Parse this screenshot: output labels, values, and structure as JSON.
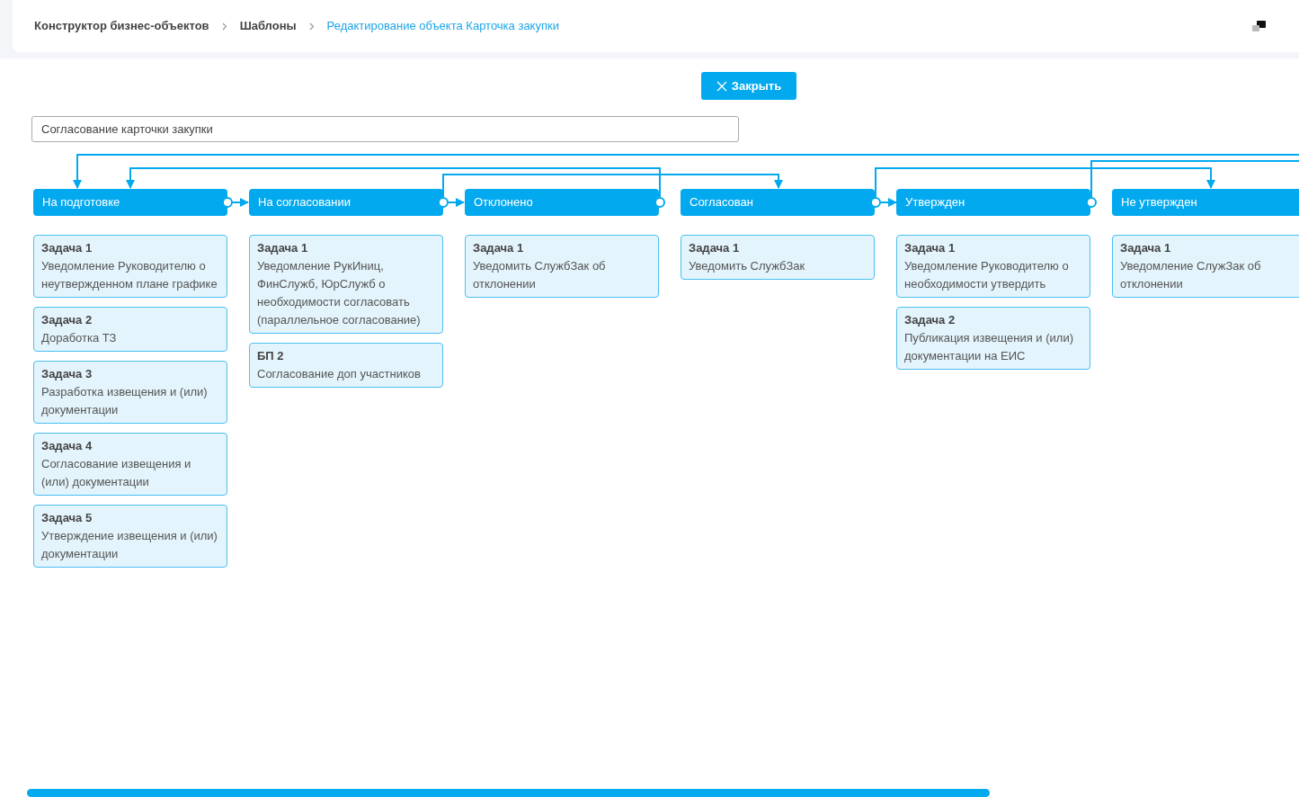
{
  "breadcrumbs": [
    {
      "label": "Конструктор бизнес-объектов",
      "current": false
    },
    {
      "label": "Шаблоны",
      "current": false
    },
    {
      "label": "Редактирование объекта Карточка закупки",
      "current": true
    }
  ],
  "close_button": {
    "label": "Закрыть"
  },
  "process_name": {
    "value": "Согласование карточки закупки"
  },
  "stages": [
    {
      "title": "На подготовке",
      "tasks": [
        {
          "title": "Задача 1",
          "description": "Уведомление Руководителю о неутвержденном плане графике"
        },
        {
          "title": "Задача 2",
          "description": "Доработка ТЗ"
        },
        {
          "title": "Задача 3",
          "description": "Разработка извещения и (или) документации"
        },
        {
          "title": "Задача 4",
          "description": "Согласование извещения и (или) документации"
        },
        {
          "title": "Задача 5",
          "description": "Утверждение извещения и (или) документации"
        }
      ]
    },
    {
      "title": "На согласовании",
      "tasks": [
        {
          "title": "Задача 1",
          "description": "Уведомление РукИниц, ФинСлужб, ЮрСлужб о необходимости согласовать (параллельное согласование)"
        },
        {
          "title": "БП 2",
          "description": "Согласование доп участников"
        }
      ]
    },
    {
      "title": "Отклонено",
      "tasks": [
        {
          "title": "Задача 1",
          "description": "Уведомить СлужбЗак об отклонении"
        }
      ]
    },
    {
      "title": "Согласован",
      "tasks": [
        {
          "title": "Задача 1",
          "description": "Уведомить СлужбЗак"
        }
      ]
    },
    {
      "title": "Утвержден",
      "tasks": [
        {
          "title": "Задача 1",
          "description": "Уведомление Руководителю о необходимости утвердить"
        },
        {
          "title": "Задача 2",
          "description": "Публикация извещения и (или) документации на ЕИС"
        }
      ]
    },
    {
      "title": "Не утвержден",
      "tasks": [
        {
          "title": "Задача 1",
          "description": "Уведомление СлужЗак об отклонении"
        }
      ]
    }
  ]
}
